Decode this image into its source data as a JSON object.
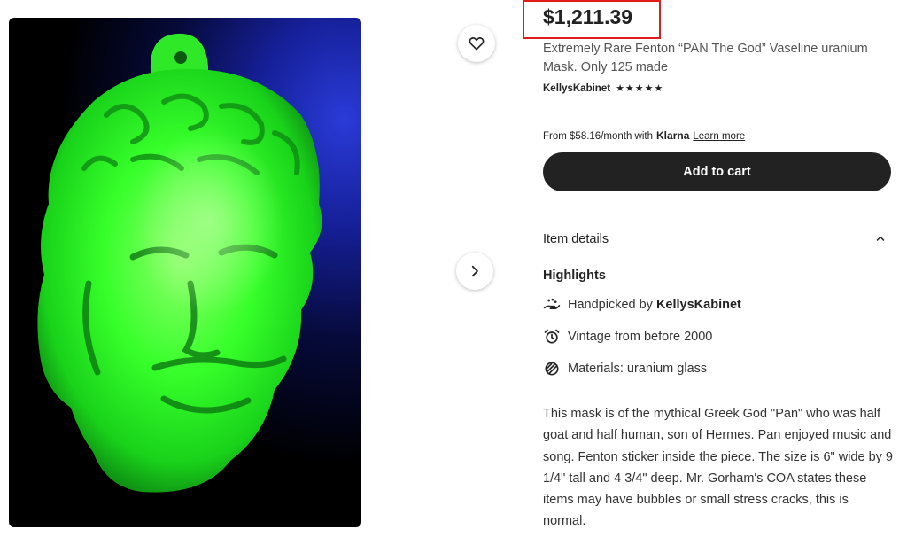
{
  "product": {
    "price": "$1,211.39",
    "title": "Extremely Rare Fenton “PAN The God” Vaseline uranium Mask. Only 125 made",
    "shop_name": "KellysKabinet",
    "rating_stars": "★★★★★",
    "rating_value": 5
  },
  "financing": {
    "prefix": "From $58.16/month with",
    "brand": "Klarna",
    "link": "Learn more"
  },
  "cart": {
    "button_label": "Add to cart"
  },
  "details": {
    "section_title": "Item details",
    "highlights_title": "Highlights",
    "handpicked_prefix": "Handpicked by",
    "handpicked_shop": "KellysKabinet",
    "vintage": "Vintage from before 2000",
    "materials": "Materials: uranium glass",
    "description": "This mask is of the mythical Greek God \"Pan\" who was half goat and half human, son of Hermes. Pan enjoyed music and song. Fenton sticker inside the piece. The size is 6\" wide by 9 1/4\" tall and 4 3/4\" deep. Mr. Gorham's COA states these items may have bubbles or small stress cracks, this is normal."
  },
  "colors": {
    "price_highlight": "#e31b1b",
    "button_bg": "#222222",
    "glass_green": "#2cff2c"
  },
  "icons": [
    "heart-icon",
    "chevron-right-icon",
    "chevron-up-icon",
    "hand-icon",
    "alarm-clock-icon",
    "materials-icon"
  ]
}
